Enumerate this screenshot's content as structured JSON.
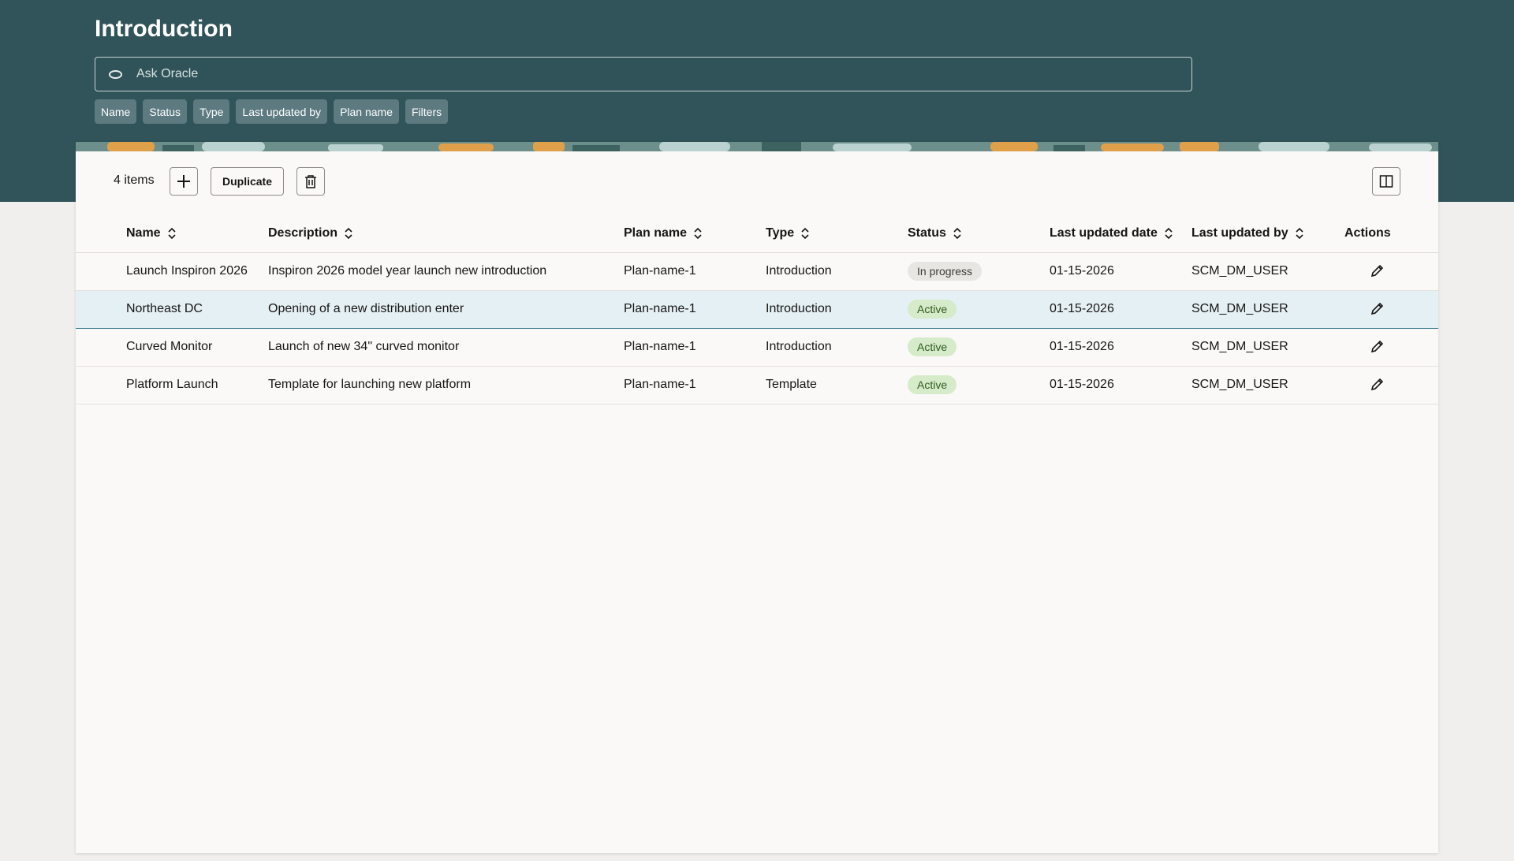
{
  "page": {
    "title": "Introduction"
  },
  "search": {
    "placeholder": "Ask Oracle",
    "value": ""
  },
  "chips": [
    "Name",
    "Status",
    "Type",
    "Last updated by",
    "Plan name",
    "Filters"
  ],
  "toolbar": {
    "items_count": "4 items",
    "duplicate_label": "Duplicate"
  },
  "table": {
    "columns": [
      "Name",
      "Description",
      "Plan name",
      "Type",
      "Status",
      "Last updated date",
      "Last updated by",
      "Actions"
    ],
    "rows": [
      {
        "name": "Launch Inspiron 2026",
        "description": "Inspiron 2026 model year launch new introduction",
        "plan_name": "Plan-name-1",
        "type": "Introduction",
        "status": "In progress",
        "date": "01-15-2026",
        "user": "SCM_DM_USER"
      },
      {
        "name": "Northeast DC",
        "description": "Opening of a new distribution enter",
        "plan_name": "Plan-name-1",
        "type": "Introduction",
        "status": "Active",
        "date": "01-15-2026",
        "user": "SCM_DM_USER"
      },
      {
        "name": "Curved Monitor",
        "description": "Launch of new 34\" curved monitor",
        "plan_name": "Plan-name-1",
        "type": "Introduction",
        "status": "Active",
        "date": "01-15-2026",
        "user": "SCM_DM_USER"
      },
      {
        "name": "Platform Launch",
        "description": "Template for launching new platform",
        "plan_name": "Plan-name-1",
        "type": "Template",
        "status": "Active",
        "date": "01-15-2026",
        "user": "SCM_DM_USER"
      }
    ]
  },
  "colors": {
    "header_bg": "#30545a",
    "chip_bg": "#5c7a80",
    "selected_row": "#e5f0f5",
    "active_badge": "#d6ebc9",
    "progress_badge": "#e8e6e3"
  },
  "icons": {
    "search": "oracle-ring-icon",
    "add": "plus-icon",
    "delete": "trash-icon",
    "columns": "columns-icon",
    "sort": "sort-icon",
    "edit": "pencil-icon"
  }
}
